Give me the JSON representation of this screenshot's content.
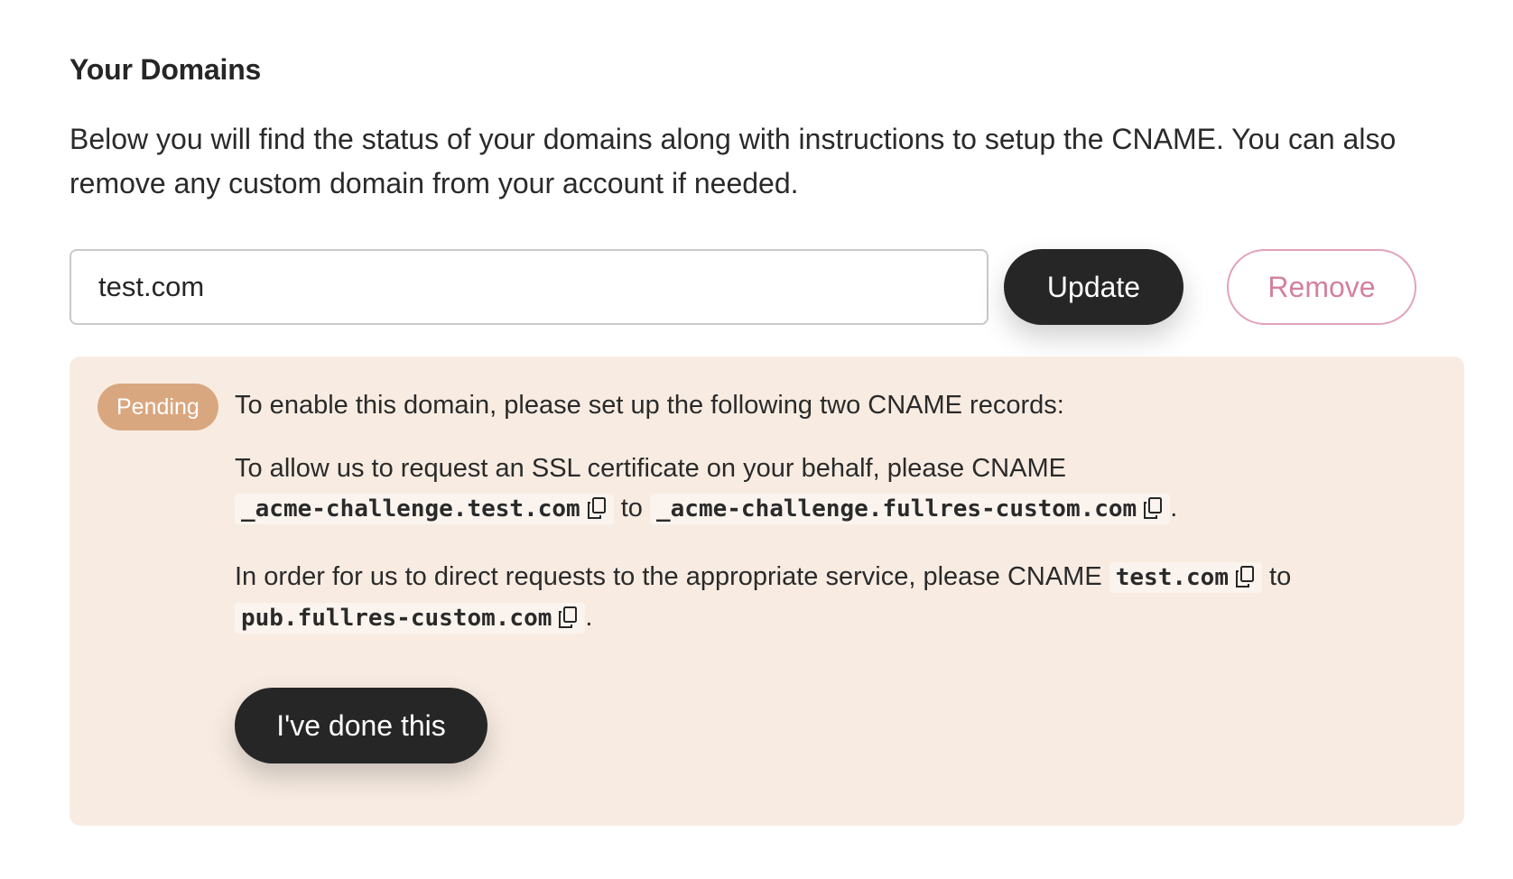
{
  "domains": {
    "title": "Your Domains",
    "description": "Below you will find the status of your domains along with instructions to setup the CNAME. You can also remove any custom domain from your account if needed.",
    "input_value": "test.com",
    "update_label": "Update",
    "remove_label": "Remove"
  },
  "status": {
    "badge": "Pending",
    "lead": "To enable this domain, please set up the following two CNAME records:",
    "ssl": {
      "text_before": "To allow us to request an SSL certificate on your behalf, please CNAME",
      "source": "_acme-challenge.test.com",
      "connector": "to",
      "target": "_acme-challenge.fullres-custom.com",
      "end": "."
    },
    "service": {
      "text_before": "In order for us to direct requests to the appropriate service, please CNAME",
      "source": "test.com",
      "connector": "to",
      "target": "pub.fullres-custom.com",
      "end": "."
    },
    "done_label": "I've done this"
  },
  "colors": {
    "panel_background": "#f8ece2",
    "badge_background": "#d9a77f",
    "remove_accent": "#d4819b",
    "button_dark": "#262626"
  },
  "icons": [
    "copy-icon"
  ]
}
